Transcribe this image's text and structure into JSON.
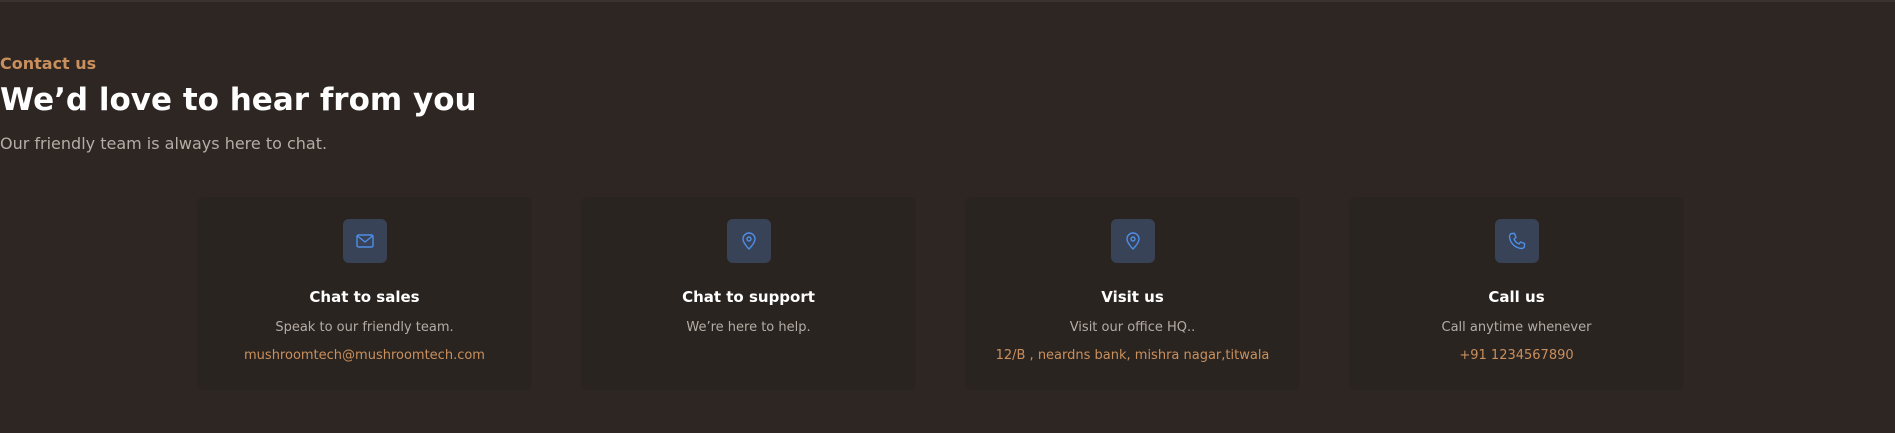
{
  "section": {
    "eyebrow": "Contact us",
    "title": "We’d love to hear from you",
    "subtitle": "Our friendly team is always here to chat."
  },
  "cards": [
    {
      "icon": "mail-icon",
      "title": "Chat to sales",
      "description": "Speak to our friendly team.",
      "link": "mushroomtech@mushroomtech.com"
    },
    {
      "icon": "map-pin-icon",
      "title": "Chat to support",
      "description": "We’re here to help.",
      "link": ""
    },
    {
      "icon": "map-pin-icon",
      "title": "Visit us",
      "description": "Visit our office HQ..",
      "link": "12/B , neardns bank, mishra nagar,titwala"
    },
    {
      "icon": "phone-icon",
      "title": "Call us",
      "description": "Call anytime whenever",
      "link": "+91 1234567890"
    }
  ],
  "colors": {
    "background": "#2e2622",
    "card": "#2a2420",
    "accent": "#c98f5d",
    "icon_bg": "#394357",
    "icon_stroke": "#4f8ee8"
  }
}
